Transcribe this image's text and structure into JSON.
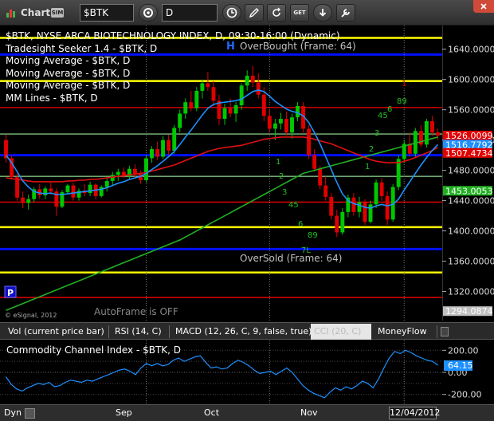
{
  "toolbar": {
    "app_label": "Chart",
    "sim_badge": "SIM",
    "symbol": "$BTK",
    "interval": "D",
    "icons": [
      "link-gear-icon",
      "clock-icon",
      "pencil-icon",
      "refresh-icon",
      "get-note-icon",
      "arrow-down-icon",
      "wrench-icon"
    ],
    "get_label": "GET"
  },
  "legend": [
    "$BTK, NYSE ARCA BIOTECHNOLOGY INDEX, D, 09:30-16:00 (Dynamic)",
    "Tradesight Seeker 1.4 - $BTK, D",
    "Moving Average - $BTK, D",
    "Moving Average - $BTK, D",
    "Moving Average - $BTK, D",
    "MM Lines - $BTK, D"
  ],
  "annotations": {
    "overbought": "OverBought (Frame: 64)",
    "oversold": "OverSold (Frame: 64)",
    "autoframe": "AutoFrame is OFF",
    "copyright": "© eSignal, 2012",
    "h_marker": "H",
    "l_marker": "7L",
    "p_marker": "P"
  },
  "colors": {
    "up": "#00c800",
    "down": "#e00000",
    "yellow_line": "#ffff00",
    "blue_line": "#0010ff",
    "red_line": "#e00000",
    "green_line": "#7fbf7f",
    "ma_blue": "#1e90ff",
    "ma_red": "#e01010",
    "ma_green": "#22b022",
    "cci": "#1e90ff"
  },
  "chart_data": [
    {
      "type": "candlestick",
      "title": "$BTK, NYSE ARCA BIOTECHNOLOGY INDEX, D, 09:30-16:00 (Dynamic)",
      "ylim": [
        1290,
        1665
      ],
      "y_ticks": [
        1320,
        1360,
        1400,
        1440,
        1480,
        1520,
        1560,
        1600,
        1640
      ],
      "x_labels": [
        "Sep",
        "Oct",
        "Nov"
      ],
      "x_label_index": [
        25,
        47,
        71
      ],
      "candles": [
        [
          1520,
          1527,
          1490,
          1496
        ],
        [
          1496,
          1500,
          1468,
          1471
        ],
        [
          1471,
          1476,
          1440,
          1444
        ],
        [
          1444,
          1452,
          1430,
          1437
        ],
        [
          1437,
          1448,
          1428,
          1442
        ],
        [
          1442,
          1458,
          1438,
          1455
        ],
        [
          1455,
          1462,
          1442,
          1447
        ],
        [
          1447,
          1459,
          1442,
          1456
        ],
        [
          1456,
          1464,
          1448,
          1452
        ],
        [
          1452,
          1456,
          1420,
          1432
        ],
        [
          1432,
          1454,
          1430,
          1451
        ],
        [
          1451,
          1462,
          1448,
          1460
        ],
        [
          1460,
          1464,
          1440,
          1444
        ],
        [
          1444,
          1456,
          1440,
          1453
        ],
        [
          1453,
          1462,
          1446,
          1450
        ],
        [
          1450,
          1465,
          1446,
          1461
        ],
        [
          1461,
          1463,
          1442,
          1446
        ],
        [
          1446,
          1460,
          1444,
          1458
        ],
        [
          1458,
          1470,
          1452,
          1466
        ],
        [
          1466,
          1478,
          1460,
          1474
        ],
        [
          1474,
          1482,
          1466,
          1478
        ],
        [
          1478,
          1484,
          1470,
          1472
        ],
        [
          1472,
          1486,
          1468,
          1482
        ],
        [
          1482,
          1488,
          1470,
          1475
        ],
        [
          1475,
          1480,
          1462,
          1467
        ],
        [
          1467,
          1500,
          1464,
          1496
        ],
        [
          1496,
          1512,
          1490,
          1508
        ],
        [
          1508,
          1518,
          1494,
          1498
        ],
        [
          1498,
          1525,
          1495,
          1520
        ],
        [
          1520,
          1527,
          1500,
          1506
        ],
        [
          1506,
          1540,
          1502,
          1536
        ],
        [
          1536,
          1560,
          1530,
          1555
        ],
        [
          1555,
          1575,
          1548,
          1570
        ],
        [
          1570,
          1585,
          1558,
          1562
        ],
        [
          1562,
          1590,
          1558,
          1585
        ],
        [
          1585,
          1600,
          1575,
          1595
        ],
        [
          1595,
          1610,
          1585,
          1590
        ],
        [
          1590,
          1598,
          1565,
          1572
        ],
        [
          1572,
          1580,
          1540,
          1548
        ],
        [
          1548,
          1568,
          1540,
          1562
        ],
        [
          1562,
          1575,
          1550,
          1555
        ],
        [
          1555,
          1570,
          1544,
          1566
        ],
        [
          1566,
          1595,
          1560,
          1592
        ],
        [
          1592,
          1612,
          1585,
          1605
        ],
        [
          1605,
          1618,
          1590,
          1596
        ],
        [
          1596,
          1608,
          1575,
          1580
        ],
        [
          1580,
          1590,
          1545,
          1552
        ],
        [
          1552,
          1560,
          1530,
          1535
        ],
        [
          1535,
          1548,
          1520,
          1542
        ],
        [
          1542,
          1556,
          1534,
          1548
        ],
        [
          1548,
          1558,
          1526,
          1530
        ],
        [
          1530,
          1555,
          1522,
          1550
        ],
        [
          1550,
          1570,
          1545,
          1565
        ],
        [
          1565,
          1570,
          1530,
          1535
        ],
        [
          1535,
          1540,
          1495,
          1500
        ],
        [
          1500,
          1508,
          1478,
          1482
        ],
        [
          1482,
          1486,
          1455,
          1460
        ],
        [
          1460,
          1472,
          1440,
          1445
        ],
        [
          1445,
          1450,
          1415,
          1420
        ],
        [
          1420,
          1428,
          1392,
          1398
        ],
        [
          1398,
          1430,
          1395,
          1425
        ],
        [
          1425,
          1448,
          1418,
          1444
        ],
        [
          1444,
          1450,
          1420,
          1425
        ],
        [
          1425,
          1445,
          1418,
          1438
        ],
        [
          1438,
          1442,
          1408,
          1412
        ],
        [
          1412,
          1440,
          1410,
          1435
        ],
        [
          1435,
          1468,
          1430,
          1464
        ],
        [
          1464,
          1470,
          1440,
          1446
        ],
        [
          1446,
          1452,
          1408,
          1415
        ],
        [
          1415,
          1462,
          1412,
          1458
        ],
        [
          1458,
          1500,
          1454,
          1495
        ],
        [
          1495,
          1520,
          1490,
          1515
        ],
        [
          1515,
          1530,
          1498,
          1502
        ],
        [
          1502,
          1536,
          1498,
          1532
        ],
        [
          1532,
          1540,
          1510,
          1514
        ],
        [
          1514,
          1548,
          1510,
          1545
        ],
        [
          1545,
          1552,
          1525,
          1530
        ],
        [
          1530,
          1535,
          1520,
          1526
        ]
      ],
      "ma_fast": [
        1500,
        1490,
        1478,
        1466,
        1458,
        1452,
        1450,
        1449,
        1450,
        1448,
        1448,
        1449,
        1450,
        1451,
        1452,
        1453,
        1454,
        1455,
        1457,
        1460,
        1463,
        1465,
        1468,
        1470,
        1472,
        1476,
        1481,
        1486,
        1492,
        1498,
        1505,
        1514,
        1524,
        1533,
        1543,
        1553,
        1562,
        1567,
        1569,
        1570,
        1571,
        1572,
        1574,
        1579,
        1584,
        1586,
        1584,
        1578,
        1571,
        1566,
        1561,
        1558,
        1556,
        1552,
        1543,
        1530,
        1515,
        1498,
        1481,
        1464,
        1449,
        1440,
        1436,
        1434,
        1431,
        1430,
        1433,
        1435,
        1433,
        1435,
        1442,
        1454,
        1465,
        1476,
        1487,
        1497,
        1506,
        1514
      ],
      "ma_mid": [
        1470,
        1469,
        1468,
        1467,
        1466,
        1465,
        1465,
        1465,
        1465,
        1465,
        1465,
        1466,
        1466,
        1467,
        1467,
        1468,
        1468,
        1469,
        1470,
        1471,
        1472,
        1473,
        1474,
        1475,
        1476,
        1477,
        1479,
        1481,
        1483,
        1485,
        1487,
        1490,
        1493,
        1496,
        1499,
        1502,
        1505,
        1507,
        1509,
        1510,
        1511,
        1512,
        1513,
        1515,
        1517,
        1519,
        1521,
        1522,
        1523,
        1524,
        1524,
        1524,
        1524,
        1524,
        1523,
        1521,
        1519,
        1517,
        1515,
        1512,
        1509,
        1506,
        1503,
        1500,
        1497,
        1494,
        1492,
        1491,
        1490,
        1490,
        1490,
        1492,
        1494,
        1497,
        1500,
        1503,
        1506,
        1510
      ],
      "ma_slow": [
        1295,
        1298,
        1301,
        1304,
        1307,
        1310,
        1313,
        1316,
        1319,
        1322,
        1325,
        1328,
        1331,
        1334,
        1337,
        1340,
        1343,
        1346,
        1349,
        1352,
        1355,
        1358,
        1361,
        1364,
        1367,
        1370,
        1373,
        1376,
        1379,
        1382,
        1385,
        1388,
        1392,
        1396,
        1400,
        1404,
        1408,
        1412,
        1416,
        1420,
        1424,
        1428,
        1432,
        1436,
        1440,
        1444,
        1448,
        1452,
        1456,
        1460,
        1464,
        1468,
        1472,
        1476,
        1478,
        1480,
        1482,
        1484,
        1486,
        1488,
        1490,
        1492,
        1494,
        1496,
        1498,
        1500,
        1502,
        1504,
        1506,
        1508,
        1510,
        1512,
        1514,
        1516,
        1518,
        1520,
        1522,
        1524
      ],
      "horizontal_lines": [
        {
          "value": 1655,
          "color": "yellow"
        },
        {
          "value": 1633,
          "color": "blue"
        },
        {
          "value": 1598,
          "color": "yellow"
        },
        {
          "value": 1563,
          "color": "red"
        },
        {
          "value": 1528,
          "color": "green"
        },
        {
          "value": 1500,
          "color": "blue"
        },
        {
          "value": 1472,
          "color": "green"
        },
        {
          "value": 1438,
          "color": "red"
        },
        {
          "value": 1405,
          "color": "yellow"
        },
        {
          "value": 1376,
          "color": "blue"
        },
        {
          "value": 1345,
          "color": "yellow"
        },
        {
          "value": 1312,
          "color": "red"
        }
      ],
      "price_labels": [
        {
          "value": "1526.0099",
          "color": "#e00000"
        },
        {
          "value": "1516.7792",
          "color": "#1e90ff"
        },
        {
          "value": "1507.4734",
          "color": "#e00000"
        },
        {
          "value": "1453.0053",
          "color": "#22b022"
        },
        {
          "value": "1294.0874",
          "color": "#c0c0c0"
        }
      ]
    },
    {
      "type": "line",
      "title": "Commodity Channel Index - $BTK, D",
      "ylim": [
        -260,
        260
      ],
      "y_ticks": [
        200,
        0,
        -200
      ],
      "last_value": "64.15",
      "values": [
        -40,
        -110,
        -150,
        -170,
        -140,
        -120,
        -100,
        -110,
        -90,
        -130,
        -120,
        -90,
        -70,
        -80,
        -90,
        -70,
        -80,
        -60,
        -40,
        -20,
        0,
        20,
        30,
        10,
        -20,
        40,
        80,
        60,
        80,
        60,
        70,
        110,
        130,
        100,
        120,
        140,
        150,
        90,
        40,
        50,
        30,
        40,
        80,
        110,
        90,
        60,
        20,
        -10,
        0,
        10,
        -20,
        10,
        40,
        0,
        -60,
        -120,
        -160,
        -190,
        -210,
        -230,
        -180,
        -140,
        -160,
        -130,
        -150,
        -120,
        -80,
        -100,
        -140,
        -60,
        40,
        130,
        190,
        170,
        200,
        180,
        150,
        130,
        110,
        100,
        64
      ]
    }
  ],
  "subtabs": [
    {
      "label": "Vol (current price bar)",
      "active": false
    },
    {
      "label": "RSI (14, C)",
      "active": false
    },
    {
      "label": "MACD (12, 26, C, 9, false, true)",
      "active": false
    },
    {
      "label": "CCI (20, C)",
      "active": true
    },
    {
      "label": "MoneyFlow",
      "active": false
    }
  ],
  "date_axis": {
    "dyn_label": "Dyn",
    "labels": [
      "Sep",
      "Oct",
      "Nov"
    ],
    "current_date": "12/04/2012"
  }
}
